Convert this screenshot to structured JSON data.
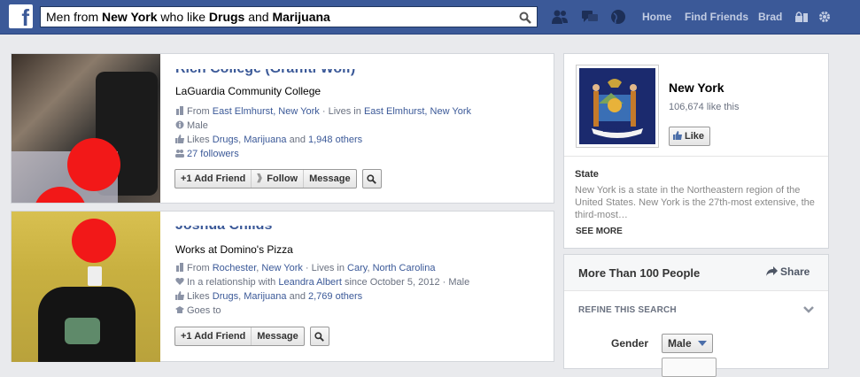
{
  "topbar": {
    "logo": "f",
    "search_parts": [
      {
        "text": "Men from ",
        "bold": false
      },
      {
        "text": "New York",
        "bold": true
      },
      {
        "text": " who like ",
        "bold": false
      },
      {
        "text": "Drugs",
        "bold": true
      },
      {
        "text": " and ",
        "bold": false
      },
      {
        "text": "Marijuana",
        "bold": true
      }
    ],
    "nav": {
      "home": "Home",
      "find_friends": "Find Friends",
      "user": "Brad"
    }
  },
  "results": [
    {
      "name": "Rich College (Graffiti Wolf)",
      "subtitle": "LaGuardia Community College",
      "from_prefix": "From ",
      "from": "East Elmhurst, New York",
      "lives_prefix": " · Lives in ",
      "lives": "East Elmhurst, New York",
      "gender": "Male",
      "likes_prefix": "Likes ",
      "likes_1": "Drugs",
      "likes_sep": ", ",
      "likes_2": "Marijuana",
      "likes_and": " and ",
      "likes_others": "1,948 others",
      "followers": "27 followers",
      "buttons": {
        "add_friend": "Add Friend",
        "follow": "Follow",
        "message": "Message"
      }
    },
    {
      "name": "Joshua Childs",
      "subtitle": "Works at Domino's Pizza",
      "from_prefix": "From ",
      "from_1": "Rochester",
      "from_sep": ", ",
      "from_2": "New York",
      "lives_prefix": " · Lives in ",
      "lives_1": "Cary",
      "lives_2": "North Carolina",
      "rel_prefix": "In a relationship with ",
      "partner": "Leandra Albert",
      "rel_suffix": " since October 5, 2012 · Male",
      "likes_prefix": "Likes ",
      "likes_1": "Drugs",
      "likes_sep": ", ",
      "likes_2": "Marijuana",
      "likes_and": " and ",
      "likes_others": "2,769 others",
      "goes_to": "Goes to",
      "buttons": {
        "add_friend": "Add Friend",
        "message": "Message"
      }
    }
  ],
  "sidebar": {
    "page_name": "New York",
    "likes": "106,674 like this",
    "like_button": "Like",
    "seal_ribbon": "EXCELSIOR",
    "section_title": "State",
    "description": "New York is a state in the Northeastern region of the United States. New York is the 27th-most extensive, the third-most…",
    "see_more": "SEE MORE",
    "people_title": "More Than 100 People",
    "share": "Share",
    "refine": "REFINE THIS SEARCH",
    "gender_label": "Gender",
    "gender_value": "Male"
  },
  "colors": {
    "brand": "#3b5998",
    "link": "#3b5998",
    "censor": "#f21818"
  }
}
